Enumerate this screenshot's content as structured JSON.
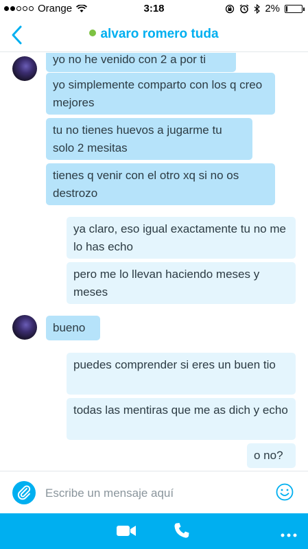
{
  "status_bar": {
    "carrier": "Orange",
    "time": "3:18",
    "battery_text": "2%",
    "battery_level": 0.02
  },
  "header": {
    "contact_name": "alvaro romero tuda",
    "presence_color": "#7dc242",
    "back_icon": "chevron-left-icon"
  },
  "messages": [
    {
      "direction": "in",
      "text": "yo no he venido con 2 a por ti"
    },
    {
      "direction": "in",
      "text": "yo simplemente comparto con los q creo mejores"
    },
    {
      "direction": "in",
      "text": "tu no tienes huevos a jugarme tu solo 2 mesitas"
    },
    {
      "direction": "in",
      "text": "tienes q venir con el otro xq si no os destrozo"
    },
    {
      "direction": "out",
      "text": "ya claro, eso igual exactamente tu no me lo has echo"
    },
    {
      "direction": "out",
      "text": "pero me lo llevan haciendo meses y meses"
    },
    {
      "direction": "in",
      "text": "bueno"
    },
    {
      "direction": "out",
      "text": "puedes comprender si eres un buen tio"
    },
    {
      "direction": "out",
      "text": "todas las mentiras que me as dich y echo"
    },
    {
      "direction": "out",
      "text": "o no?"
    }
  ],
  "composer": {
    "placeholder": "Escribe un mensaje aquí",
    "attach_icon": "paperclip-icon",
    "emoji_icon": "smiley-icon"
  },
  "toolbar": {
    "icons": [
      "video-call-icon",
      "phone-icon",
      "more-icon"
    ]
  },
  "colors": {
    "accent": "#00aff0",
    "incoming_bubble": "#b6e3fa",
    "outgoing_bubble": "#e4f5fd"
  }
}
